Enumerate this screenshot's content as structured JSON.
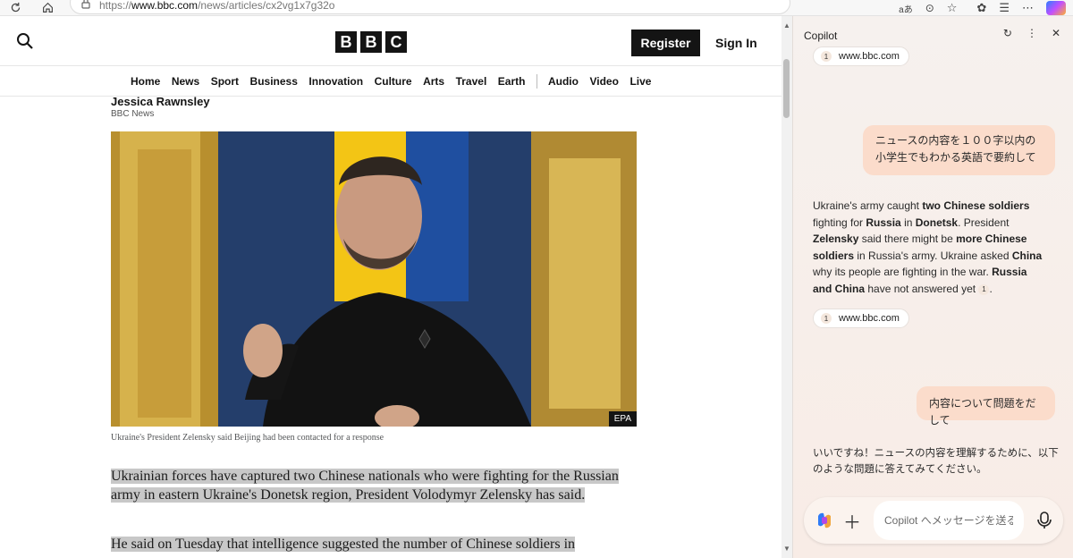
{
  "browser": {
    "url_scheme": "https://",
    "url_host": "www.bbc.com",
    "url_path": "/news/articles/cx2vg1x7g32o"
  },
  "bbc": {
    "logo_letters": [
      "B",
      "B",
      "C"
    ],
    "register_label": "Register",
    "signin_label": "Sign In",
    "nav": [
      "Home",
      "News",
      "Sport",
      "Business",
      "Innovation",
      "Culture",
      "Arts",
      "Travel",
      "Earth",
      "Audio",
      "Video",
      "Live"
    ],
    "author": "Jessica Rawnsley",
    "org": "BBC News",
    "photo_credit": "EPA",
    "caption": "Ukraine's President Zelensky said Beijing had been contacted for a response",
    "para1": "Ukrainian forces have captured two Chinese nationals who were fighting for the Russian army in eastern Ukraine's Donetsk region, President Volodymyr Zelensky has said.",
    "para2": "He said on Tuesday that intelligence suggested the number of Chinese soldiers in"
  },
  "copilot": {
    "title": "Copilot",
    "source_num": "1",
    "source_label": "www.bbc.com",
    "user_msg1": "ニュースの内容を１００字以内の小学生でもわかる英語で要約して",
    "answer_parts": [
      "Ukraine's army caught ",
      "two Chinese soldiers",
      " fighting for ",
      "Russia",
      " in ",
      "Donetsk",
      ". President ",
      "Zelensky",
      " said there might be ",
      "more Chinese soldiers",
      " in Russia's army. Ukraine asked ",
      "China",
      " why its people are fighting in the war. ",
      "Russia and China",
      " have not answered yet"
    ],
    "user_msg2": "内容について問題をだして",
    "answer2": "いいですね！ニュースの内容を理解するために、以下のような問題に答えてみてください。",
    "input_placeholder": "Copilot へメッセージを送る"
  }
}
